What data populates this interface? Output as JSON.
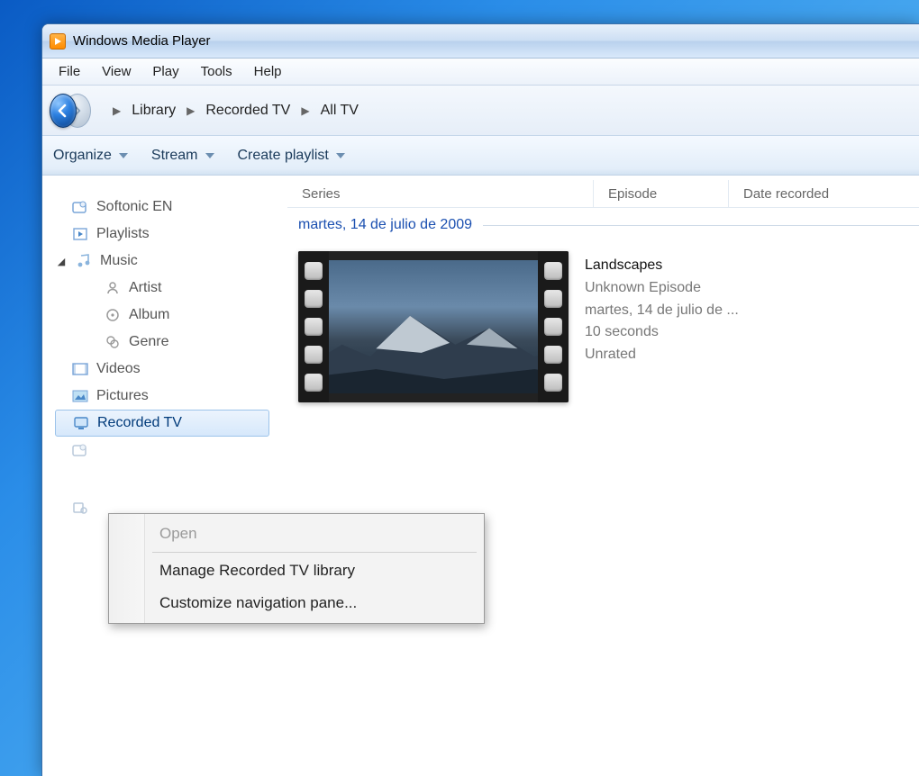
{
  "window": {
    "title": "Windows Media Player"
  },
  "menubar": [
    "File",
    "View",
    "Play",
    "Tools",
    "Help"
  ],
  "breadcrumb": [
    "Library",
    "Recorded TV",
    "All TV"
  ],
  "toolbar": {
    "organize": "Organize",
    "stream": "Stream",
    "createPlaylist": "Create playlist"
  },
  "sidebar": {
    "items": [
      {
        "label": "Softonic EN",
        "icon": "library-icon"
      },
      {
        "label": "Playlists",
        "icon": "playlist-icon"
      },
      {
        "label": "Music",
        "icon": "music-icon",
        "expanded": true
      },
      {
        "label": "Artist",
        "icon": "artist-icon",
        "child": true
      },
      {
        "label": "Album",
        "icon": "album-icon",
        "child": true
      },
      {
        "label": "Genre",
        "icon": "genre-icon",
        "child": true
      },
      {
        "label": "Videos",
        "icon": "videos-icon"
      },
      {
        "label": "Pictures",
        "icon": "pictures-icon"
      },
      {
        "label": "Recorded TV",
        "icon": "tv-icon",
        "selected": true
      }
    ]
  },
  "columns": {
    "series": "Series",
    "episode": "Episode",
    "dateRecorded": "Date recorded"
  },
  "group": {
    "date": "martes, 14 de julio de 2009"
  },
  "video": {
    "title": "Landscapes",
    "episode": "Unknown Episode",
    "date": "martes, 14 de julio de ...",
    "duration": "10 seconds",
    "rating": "Unrated"
  },
  "contextMenu": {
    "open": "Open",
    "manage": "Manage Recorded TV library",
    "customize": "Customize navigation pane..."
  }
}
